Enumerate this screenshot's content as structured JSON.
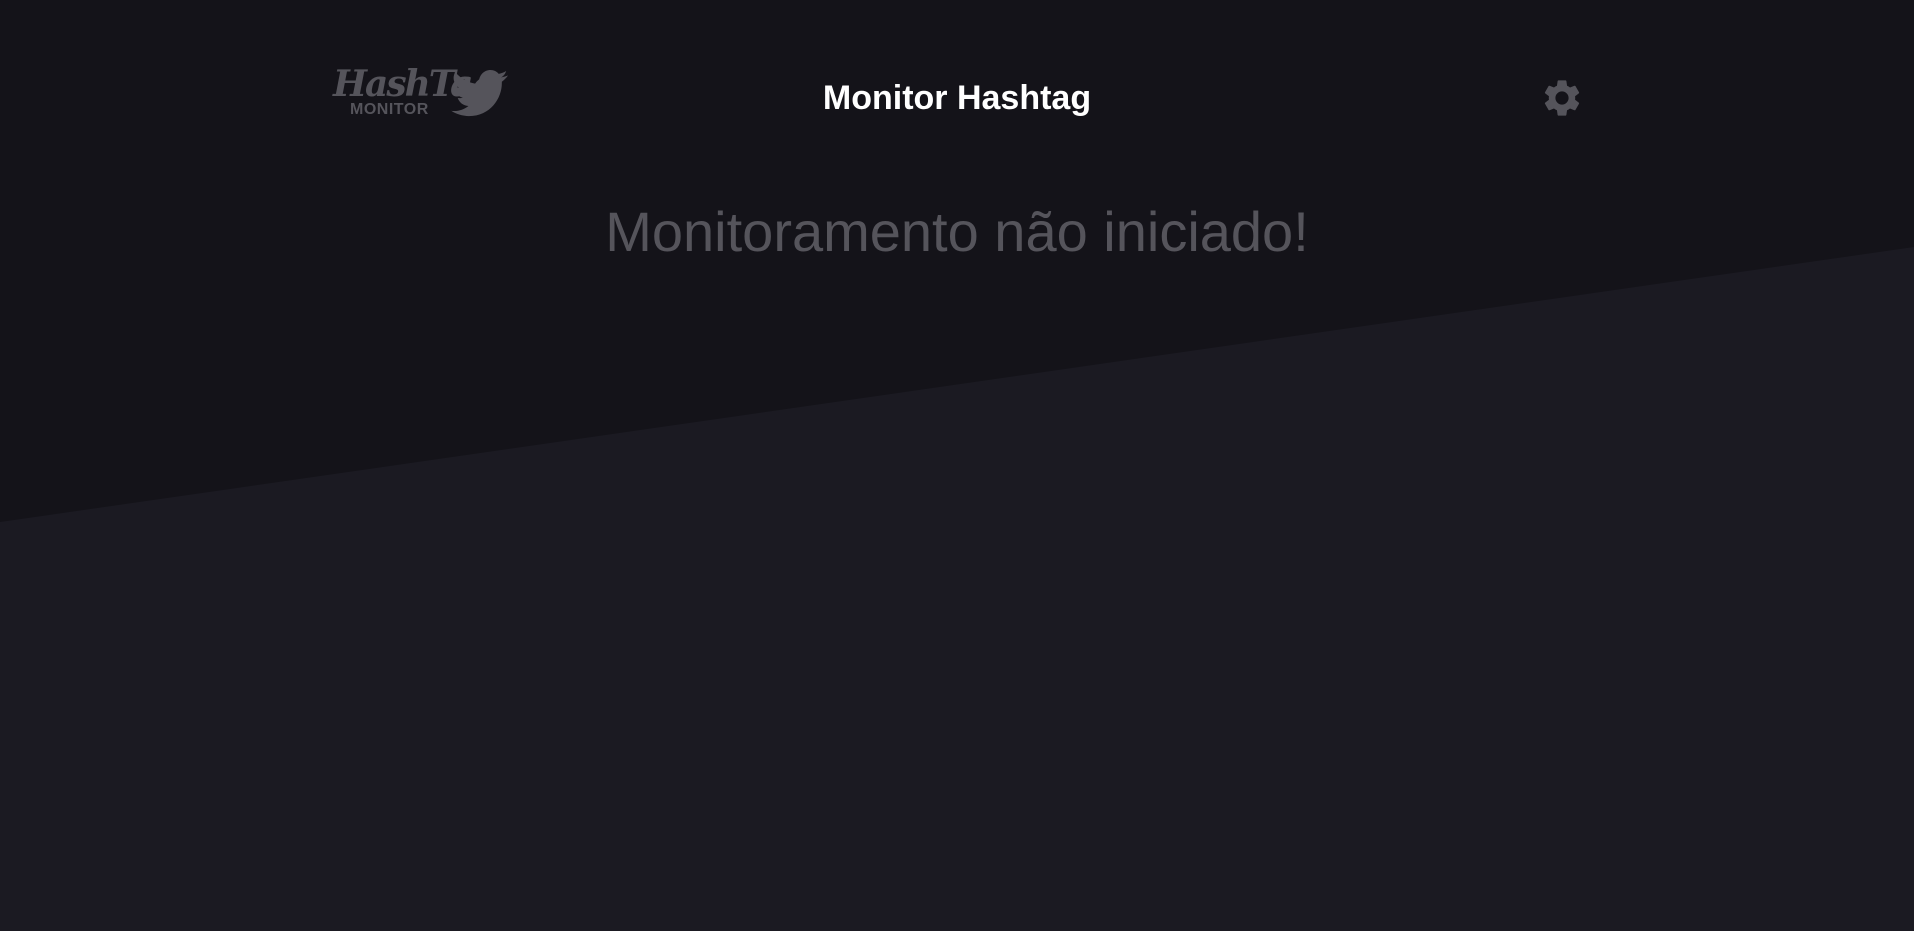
{
  "header": {
    "logo": {
      "wordmark": "HashTag",
      "subtitle": "MONITOR",
      "icon": "twitter-bird-icon"
    },
    "title": "Monitor Hashtag",
    "settings_icon": "gear-icon"
  },
  "main": {
    "status_message": "Monitoramento não iniciado!"
  },
  "colors": {
    "background_top": "#141319",
    "background_bottom": "#1b1a22",
    "title_text": "#ffffff",
    "muted_text": "#55545b",
    "icon": "#55545b"
  }
}
